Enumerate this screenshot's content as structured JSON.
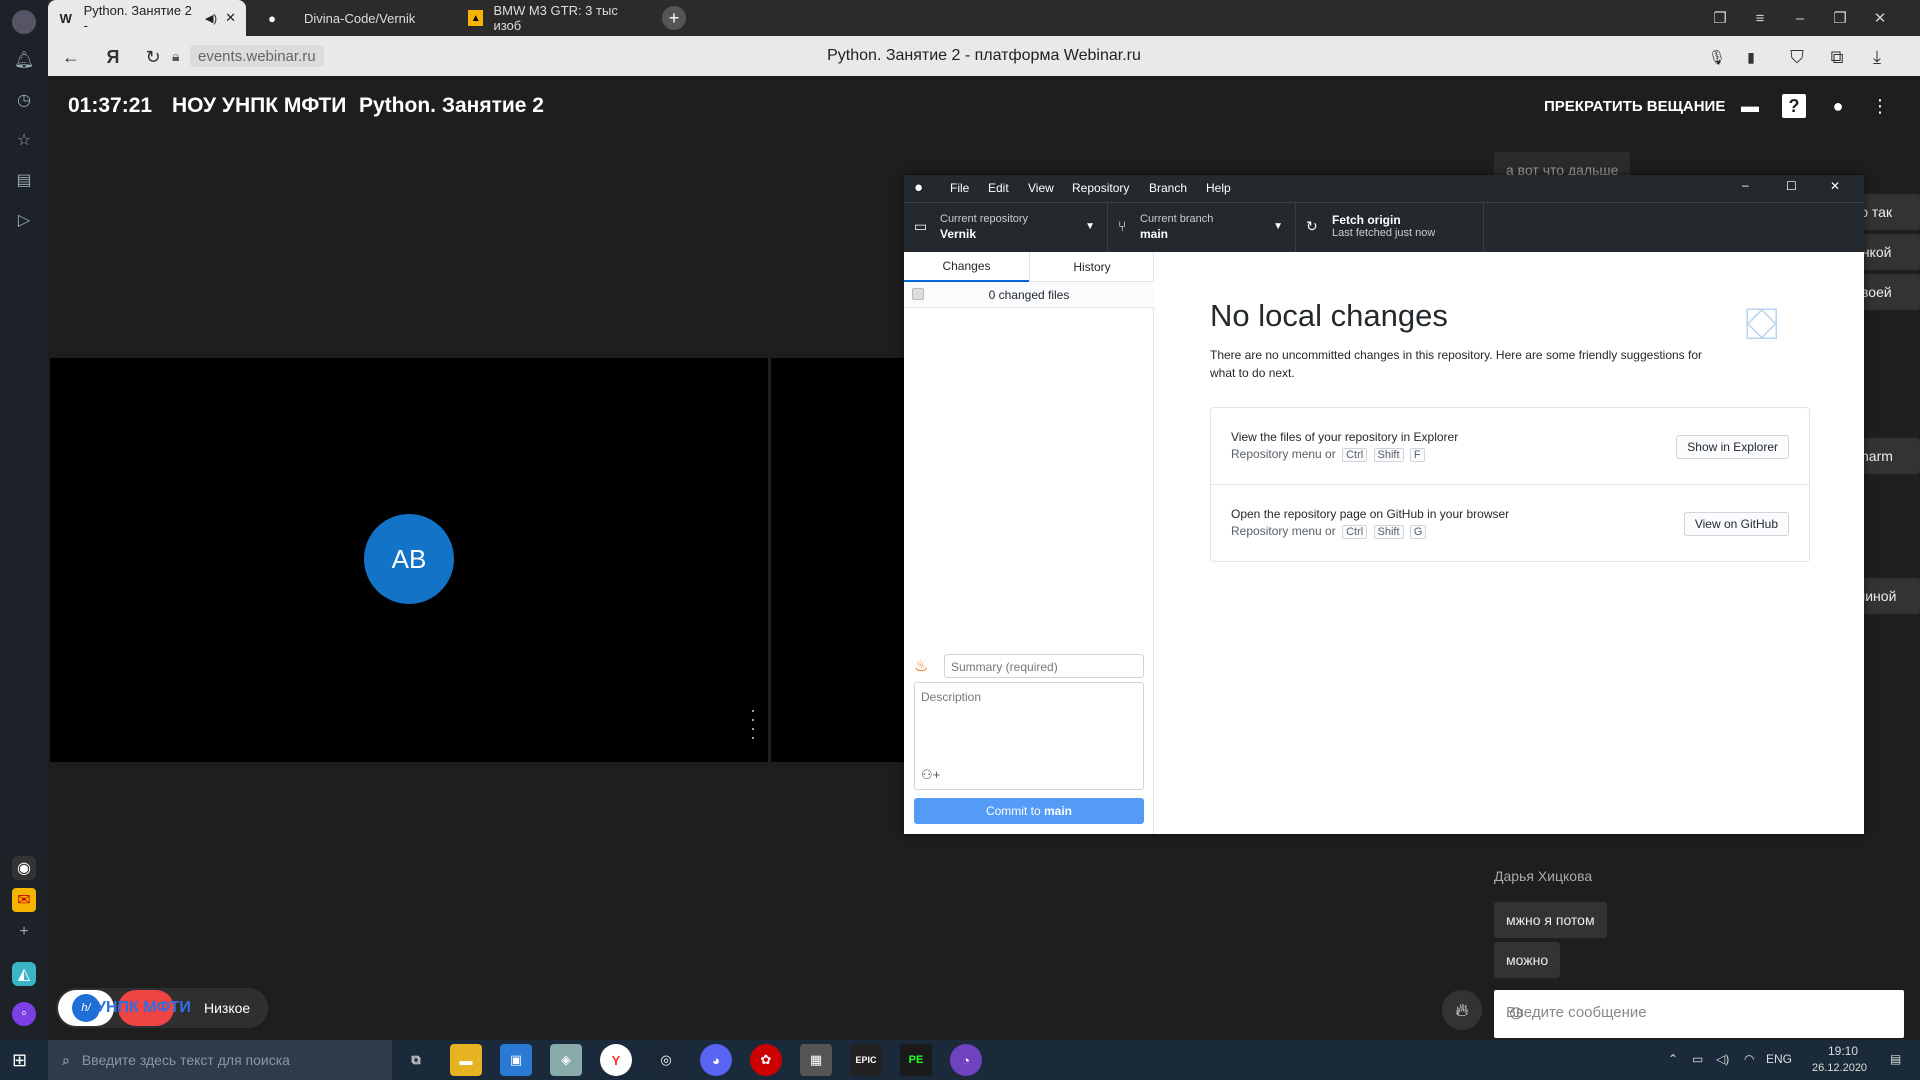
{
  "browser": {
    "tabs": [
      {
        "label": "Python. Занятие 2 -",
        "favicon": "W"
      },
      {
        "label": "Divina-Code/Vernik",
        "favicon": "github-icon"
      },
      {
        "label": "BMW M3 GTR: 3 тыс изоб",
        "favicon": "image-icon"
      }
    ],
    "url": "events.webinar.ru",
    "page_title": "Python. Занятие 2 - платформа Webinar.ru"
  },
  "webinar": {
    "timer": "01:37:21",
    "org": "НОУ УНПК МФТИ",
    "title": "Python. Занятие 2",
    "stop_label": "ПРЕКРАТИТЬ ВЕЩАНИЕ",
    "participant_initials": "AB",
    "quality_label": "Низкое",
    "logo_text": "УНПК МФТИ",
    "chat": {
      "messages_partial": [
        "а вот что дальше",
        "то так",
        "инкой",
        "своей",
        "charm",
        "шиной"
      ],
      "author": "Дарья Хицкова",
      "messages": [
        "мжно я потом",
        "можно"
      ],
      "input_placeholder": "Введите сообщение"
    }
  },
  "github_desktop": {
    "menu": [
      "File",
      "Edit",
      "View",
      "Repository",
      "Branch",
      "Help"
    ],
    "current_repository_label": "Current repository",
    "current_repository": "Vernik",
    "current_branch_label": "Current branch",
    "current_branch": "main",
    "fetch_label": "Fetch origin",
    "fetch_sub": "Last fetched just now",
    "tab_changes": "Changes",
    "tab_history": "History",
    "changed_files": "0 changed files",
    "summary_placeholder": "Summary (required)",
    "description_placeholder": "Description",
    "commit_prefix": "Commit to",
    "commit_branch": "main",
    "no_changes_title": "No local changes",
    "no_changes_sub": "There are no uncommitted changes in this repository. Here are some friendly suggestions for what to do next.",
    "suggestions": [
      {
        "title": "View the files of your repository in Explorer",
        "sub": "Repository menu or",
        "keys": [
          "Ctrl",
          "Shift",
          "F"
        ],
        "button": "Show in Explorer"
      },
      {
        "title": "Open the repository page on GitHub in your browser",
        "sub": "Repository menu or",
        "keys": [
          "Ctrl",
          "Shift",
          "G"
        ],
        "button": "View on GitHub"
      }
    ]
  },
  "taskbar": {
    "search_placeholder": "Введите здесь текст для поиска",
    "lang": "ENG",
    "time": "19:10",
    "date": "26.12.2020"
  }
}
